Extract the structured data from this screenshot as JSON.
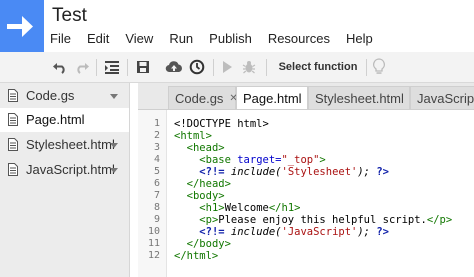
{
  "app": {
    "title": "Test"
  },
  "menu": [
    "File",
    "Edit",
    "View",
    "Run",
    "Publish",
    "Resources",
    "Help"
  ],
  "toolbar": {
    "select_function_label": "Select function"
  },
  "sidebar": {
    "files": [
      {
        "label": "Code.gs"
      },
      {
        "label": "Page.html"
      },
      {
        "label": "Stylesheet.html"
      },
      {
        "label": "JavaScript.html"
      }
    ]
  },
  "tabs": [
    {
      "label": "Code.gs"
    },
    {
      "label": "Page.html"
    },
    {
      "label": "Stylesheet.html"
    },
    {
      "label": "JavaScript.htm"
    }
  ],
  "editor": {
    "line_numbers": [
      "1",
      "2",
      "3",
      "4",
      "5",
      "6",
      "7",
      "8",
      "9",
      "10",
      "11",
      "12"
    ],
    "lines": {
      "l1": "<!DOCTYPE html>",
      "l2": "<html>",
      "l3": "<head>",
      "l4_tag_open": "<base",
      "l4_attr": " target=",
      "l4_val": "\"_top\"",
      "l4_tag_close": ">",
      "l5_open": "<?!=",
      "l5_fn": " include(",
      "l5_arg": "'Stylesheet'",
      "l5_end": "); ",
      "l5_close": "?>",
      "l6": "</head>",
      "l7": "<body>",
      "l8_open": "<h1>",
      "l8_text": "Welcome",
      "l8_close": "</h1>",
      "l9_open": "<p>",
      "l9_text": "Please enjoy this helpful script.",
      "l9_close": "</p>",
      "l10_open": "<?!=",
      "l10_fn": " include(",
      "l10_arg": "'JavaScript'",
      "l10_end": "); ",
      "l10_close": "?>",
      "l11": "</body>",
      "l12": "</html>"
    }
  },
  "colors": {
    "logo_blue": "#4a8af4",
    "tag_green": "#117700",
    "string_red": "#aa1111",
    "keyword_blue": "#1122aa"
  }
}
